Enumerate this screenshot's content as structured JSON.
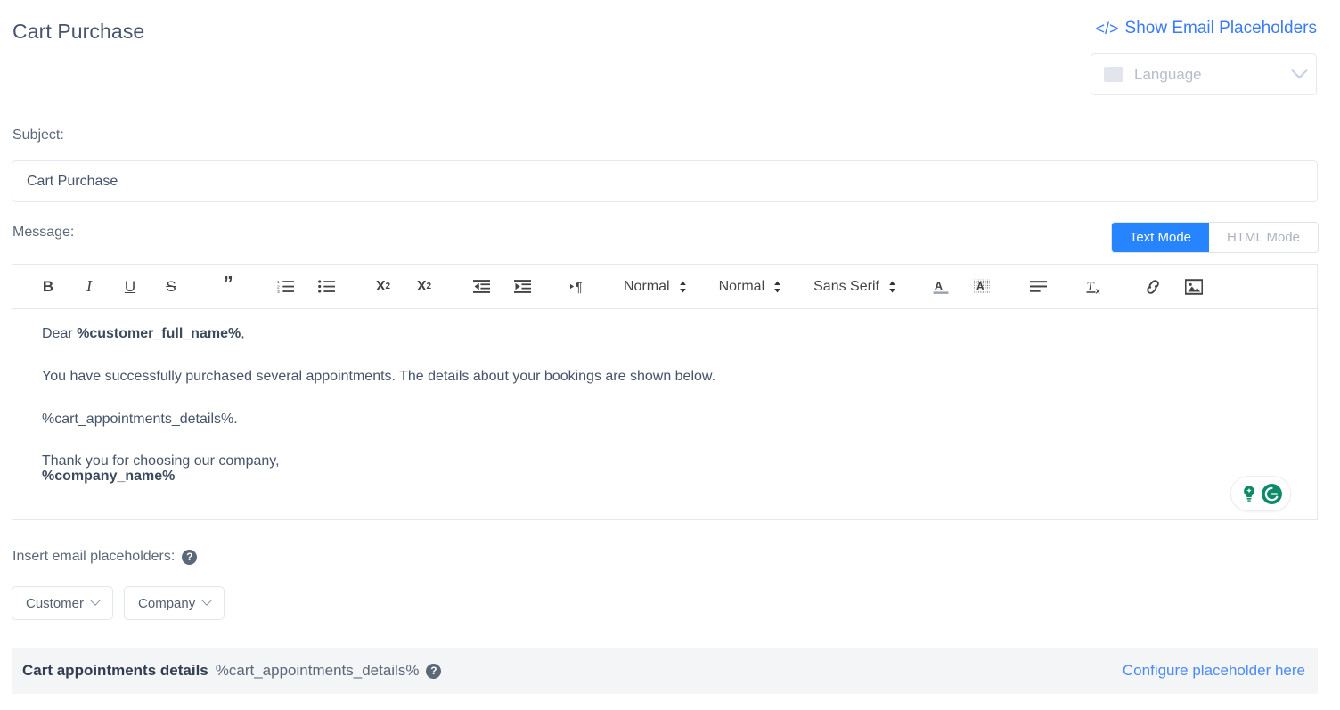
{
  "header": {
    "title": "Cart Purchase",
    "show_placeholders_label": "Show Email Placeholders",
    "code_glyph": "</>",
    "language_select": {
      "placeholder": "Language",
      "chevron_icon": "chevron-down-icon",
      "flag_swatch": "flag-placeholder-swatch"
    }
  },
  "subject": {
    "label": "Subject:",
    "value": "Cart Purchase"
  },
  "message": {
    "label": "Message:",
    "mode_toggle": {
      "text_mode": "Text Mode",
      "html_mode": "HTML Mode",
      "active": "Text Mode",
      "active_color": "#2684ff"
    },
    "toolbar": {
      "bold": "B",
      "italic": "I",
      "underline": "U",
      "strike": "S",
      "blockquote": "”",
      "ordered_list": "ordered-list-icon",
      "bullet_list": "bullet-list-icon",
      "subscript_base": "X",
      "subscript_index": "2",
      "superscript_base": "X",
      "superscript_index": "2",
      "outdent": "outdent-icon",
      "indent": "indent-icon",
      "direction": "text-direction-icon",
      "size_picker": "Normal",
      "header_picker": "Normal",
      "font_picker": "Sans Serif",
      "text_color": "text-color-icon",
      "background_color": "background-color-icon",
      "align": "align-icon",
      "clean": "clear-formatting-icon",
      "link": "link-icon",
      "image": "image-icon"
    },
    "body": {
      "line1_prefix": "Dear ",
      "line1_placeholder": "%customer_full_name%",
      "line1_suffix": ",",
      "line2": "You have successfully purchased several appointments. The details about your bookings are shown below.",
      "line3": "%cart_appointments_details%.",
      "line4": "Thank you for choosing our company,",
      "line5_placeholder": "%company_name%"
    },
    "grammarly_badge": {
      "bulb_icon": "lightbulb-icon",
      "logo_icon": "grammarly-logo-icon",
      "color": "#0d8a68"
    }
  },
  "insert_placeholders": {
    "label": "Insert email placeholders:",
    "help_icon": "help-icon",
    "help_glyph": "?",
    "buttons": [
      {
        "label": "Customer",
        "icon": "chevron-down-icon"
      },
      {
        "label": "Company",
        "icon": "chevron-down-icon"
      }
    ]
  },
  "bottom_bar": {
    "title": "Cart appointments details",
    "placeholder": "%cart_appointments_details%",
    "help_icon": "help-icon",
    "help_glyph": "?",
    "configure_link": "Configure placeholder here",
    "background": "#f4f5f7",
    "link_color": "#4b8bf4"
  }
}
